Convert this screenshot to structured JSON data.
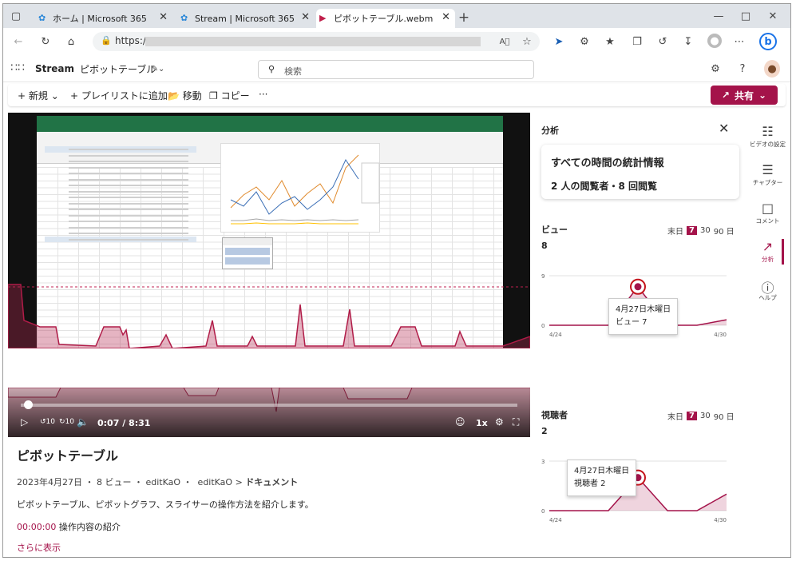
{
  "browser": {
    "tabs": [
      {
        "label": "ホーム | Microsoft 365"
      },
      {
        "label": "Stream | Microsoft 365"
      },
      {
        "label": "ピボットテーブル.webm"
      }
    ],
    "url_prefix": "https://",
    "new_tab": "+"
  },
  "app": {
    "name": "Stream",
    "doc_title": "ピボットテーブル",
    "search_placeholder": "検索"
  },
  "commands": {
    "new": "新規",
    "add_playlist": "プレイリストに追加",
    "move": "移動",
    "copy": "コピー",
    "more": "···",
    "share": "共有"
  },
  "player": {
    "time": "0:07 / 8:31",
    "speed": "1x",
    "progress": 0.014
  },
  "video": {
    "title": "ピボットテーブル",
    "date": "2023年4月27日",
    "views": "8 ビュー",
    "owner": "editKaO",
    "path_owner": "editKaO",
    "path_folder": "ドキュメント",
    "description": "ピボットテーブル、ピボットグラフ、スライサーの操作方法を紹介します。",
    "chapter_time": "00:00:00",
    "chapter_title": "操作内容の紹介",
    "show_more": "さらに表示"
  },
  "analytics": {
    "title": "分析",
    "stat_title": "すべての時間の統計情報",
    "stat_summary": "2 人の閲覧者・8 回閲覧",
    "range_label": "末日",
    "range_options": [
      "7",
      "30",
      "90 日"
    ],
    "views": {
      "label": "ビュー",
      "total": "8",
      "ymax": "9",
      "ymin": "0",
      "x_start": "4/24",
      "x_end": "4/30",
      "tooltip_date": "4月27日木曜日",
      "tooltip_value": "ビュー 7"
    },
    "viewers": {
      "label": "視聴者",
      "total": "2",
      "ymax": "3",
      "ymin": "0",
      "x_start": "4/24",
      "x_end": "4/30",
      "tooltip_date": "4月27日木曜日",
      "tooltip_value": "視聴者 2"
    }
  },
  "rail": {
    "settings": "ビデオの設定",
    "chapters": "チャプター",
    "comments": "コメント",
    "analytics": "分析",
    "help": "ヘルプ"
  },
  "chart_data": [
    {
      "type": "area",
      "title": "ビュー",
      "x": [
        "4/24",
        "4/25",
        "4/26",
        "4/27",
        "4/28",
        "4/29",
        "4/30"
      ],
      "values": [
        0,
        0,
        0,
        7,
        0,
        0,
        1
      ],
      "ylim": [
        0,
        9
      ]
    },
    {
      "type": "area",
      "title": "視聴者",
      "x": [
        "4/24",
        "4/25",
        "4/26",
        "4/27",
        "4/28",
        "4/29",
        "4/30"
      ],
      "values": [
        0,
        0,
        0,
        2,
        0,
        0,
        1
      ],
      "ylim": [
        0,
        3
      ]
    }
  ],
  "colors": {
    "accent": "#a4134a",
    "excel_green": "#217346"
  }
}
